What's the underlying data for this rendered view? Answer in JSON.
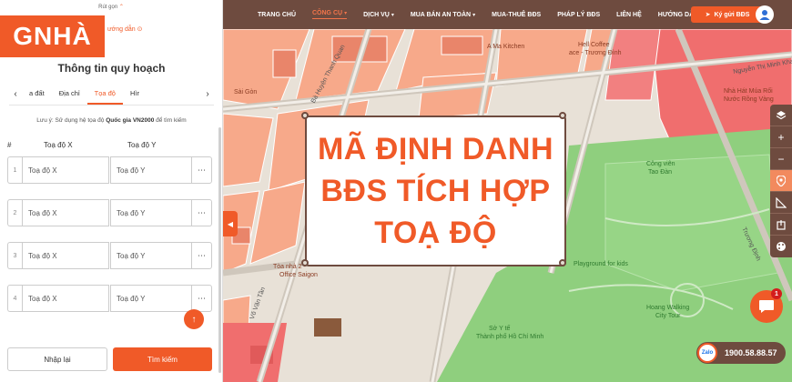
{
  "panel": {
    "collapse_text": "Rút gọn",
    "logo_text": "GNHÀ",
    "guide_text": "ướng dẫn",
    "title": "Thông tin quy hoạch",
    "tabs": [
      "a đất",
      "Địa chỉ",
      "Tọa độ",
      "Hìr"
    ],
    "note_prefix": "Lưu ý: Sử dụng hệ tọa độ ",
    "note_bold": "Quốc gia VN2000",
    "note_suffix": " để tìm kiếm",
    "col_index": "#",
    "col_x": "Toạ độ X",
    "col_y": "Toạ độ Y",
    "rows": [
      {
        "idx": "1",
        "x_placeholder": "Toạ độ X",
        "y_placeholder": "Toạ độ Y"
      },
      {
        "idx": "2",
        "x_placeholder": "Toạ độ X",
        "y_placeholder": "Toạ độ Y"
      },
      {
        "idx": "3",
        "x_placeholder": "Toạ độ X",
        "y_placeholder": "Toạ độ Y"
      },
      {
        "idx": "4",
        "x_placeholder": "Toạ độ X",
        "y_placeholder": "Toạ độ Y"
      }
    ],
    "more_label": "⋯",
    "reset_label": "Nhập lại",
    "search_label": "Tìm kiếm"
  },
  "nav": {
    "items": [
      "TRANG CHỦ",
      "CÔNG CỤ",
      "DỊCH VỤ",
      "MUA BÁN AN TOÀN",
      "MUA-THUÊ BĐS",
      "PHÁP LÝ BĐS",
      "LIÊN HỆ",
      "HƯỚNG DẪN"
    ],
    "active_index": 1,
    "post_label": "Ký gửi BĐS"
  },
  "promo": {
    "lines": [
      "MÃ ĐỊNH DANH",
      "BĐS TÍCH HỢP",
      "TOẠ ĐỘ"
    ]
  },
  "map_labels": {
    "a_ma_kitchen": "A Ma Kitchen",
    "coffee": "Hell Coffee",
    "coffee2": "ace - Trương Đình",
    "nha_hat": "Nhà Hát Múa Rối",
    "nha_hat2": "Nước Rồng Vàng",
    "cong_vien": "Công viên",
    "cong_vien2": "Tao Đàn",
    "playground": "Playground for kids",
    "walking": "Hoang Walking",
    "walking2": "City Tour",
    "so_y_te": "Sở Y tế",
    "so_y_te2": "Thành phố Hồ Chí Minh",
    "office": "Tòa nhà 2 -",
    "office2": "Office Saigon",
    "vo_van_tan": "Võ Văn Tần",
    "street1": "Bà Huyện Thanh Quan",
    "street2": "Trương Định",
    "quan": "Sài Gòn",
    "nguyen_thi": "Nguyễn Thị Minh Khai"
  },
  "hotline": {
    "zalo": "Zalo",
    "number": "1900.58.88.57"
  },
  "chat_badge": "1",
  "colors": {
    "accent": "#f05a28",
    "nav_bg": "#6e4b3f",
    "map_orange": "#f7a98a",
    "map_green": "#8fcf7e"
  }
}
